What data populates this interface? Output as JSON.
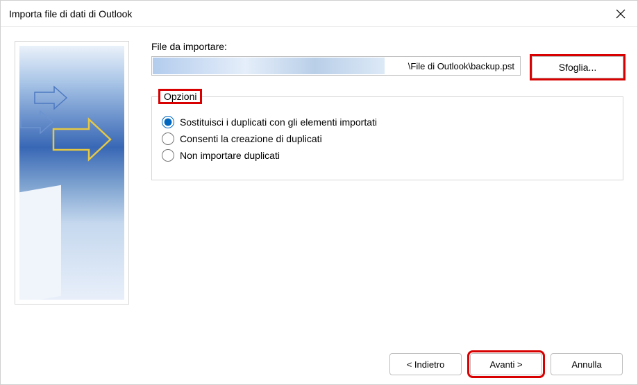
{
  "title": "Importa file di dati di Outlook",
  "file_label": "File da importare:",
  "file_path_visible": "\\File di Outlook\\backup.pst",
  "browse_label": "Sfoglia...",
  "options_legend": "Opzioni",
  "options": {
    "replace": {
      "label": "Sostituisci i duplicati con gli elementi importati",
      "checked": true
    },
    "allow": {
      "label": "Consenti la creazione di duplicati",
      "checked": false
    },
    "skip": {
      "label": "Non importare duplicati",
      "checked": false
    }
  },
  "buttons": {
    "back": "< Indietro",
    "next": "Avanti >",
    "cancel": "Annulla"
  }
}
